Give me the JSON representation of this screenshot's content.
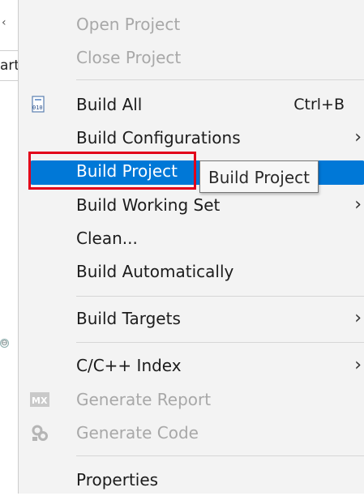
{
  "background": {
    "tab_stub_text": "artu",
    "collapse_glyph": "⊖"
  },
  "menu": {
    "items": [
      {
        "label": "Open Project",
        "enabled": false
      },
      {
        "label": "Close Project",
        "enabled": false
      },
      {
        "label": "Build All",
        "shortcut": "Ctrl+B",
        "icon": "build-all-icon",
        "enabled": true
      },
      {
        "label": "Build Configurations",
        "submenu": true,
        "enabled": true
      },
      {
        "label": "Build Project",
        "enabled": true,
        "highlighted": true
      },
      {
        "label": "Build Working Set",
        "submenu": true,
        "enabled": true
      },
      {
        "label": "Clean...",
        "enabled": true
      },
      {
        "label": "Build Automatically",
        "enabled": true
      },
      {
        "label": "Build Targets",
        "submenu": true,
        "enabled": true
      },
      {
        "label": "C/C++ Index",
        "submenu": true,
        "enabled": true
      },
      {
        "label": "Generate Report",
        "icon": "mx-icon",
        "enabled": false
      },
      {
        "label": "Generate Code",
        "icon": "gear-icon",
        "enabled": false
      },
      {
        "label": "Properties",
        "enabled": true
      }
    ],
    "submenu_glyph": "›",
    "icon_text": {
      "build_all": "010",
      "mx": "MX"
    }
  },
  "tooltip": {
    "text": "Build Project"
  },
  "colors": {
    "highlight": "#0078d7",
    "annotation_red": "#e2001a",
    "disabled_text": "#a8a8a8"
  }
}
